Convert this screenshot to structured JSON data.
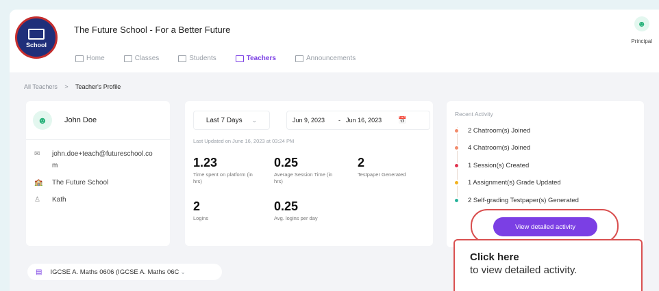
{
  "header": {
    "logo_text": "School",
    "school_name": "The Future School - For a Better Future",
    "nav": [
      {
        "label": "Home",
        "active": false
      },
      {
        "label": "Classes",
        "active": false
      },
      {
        "label": "Students",
        "active": false
      },
      {
        "label": "Teachers",
        "active": true
      },
      {
        "label": "Announcements",
        "active": false
      }
    ],
    "user_role": "Principal"
  },
  "breadcrumb": {
    "parent": "All Teachers",
    "separator": ">",
    "current": "Teacher's Profile"
  },
  "profile": {
    "name": "John Doe",
    "email": "john.doe+teach@futureschool.com",
    "school": "The Future School",
    "location": "Kath"
  },
  "stats": {
    "range": "Last 7 Days",
    "date_from": "Jun 9, 2023",
    "date_sep": "-",
    "date_to": "Jun 16, 2023",
    "updated": "Last Updated on June 16, 2023 at 03:24 PM",
    "items": [
      {
        "value": "1.23",
        "label": "Time spent on platform (in hrs)"
      },
      {
        "value": "0.25",
        "label": "Average Session Time (in hrs)"
      },
      {
        "value": "2",
        "label": "Testpaper Generated"
      },
      {
        "value": "2",
        "label": "Logins"
      },
      {
        "value": "0.25",
        "label": "Avg. logins per day"
      }
    ]
  },
  "activity": {
    "title": "Recent Activity",
    "items": [
      {
        "text": "2 Chatroom(s) Joined",
        "color": "#f28b6b"
      },
      {
        "text": "4 Chatroom(s) Joined",
        "color": "#f28b6b"
      },
      {
        "text": "1 Session(s) Created",
        "color": "#e0344f"
      },
      {
        "text": "1 Assignment(s) Grade Updated",
        "color": "#f2b21f"
      },
      {
        "text": "2 Self-grading Testpaper(s) Generated",
        "color": "#27b39b"
      }
    ],
    "button_label": "View detailed activity"
  },
  "tooltip": {
    "title": "Click here",
    "subtitle": "to view detailed activity."
  },
  "course": {
    "label": "IGCSE A. Maths 0606 (IGCSE A. Maths 06C"
  }
}
